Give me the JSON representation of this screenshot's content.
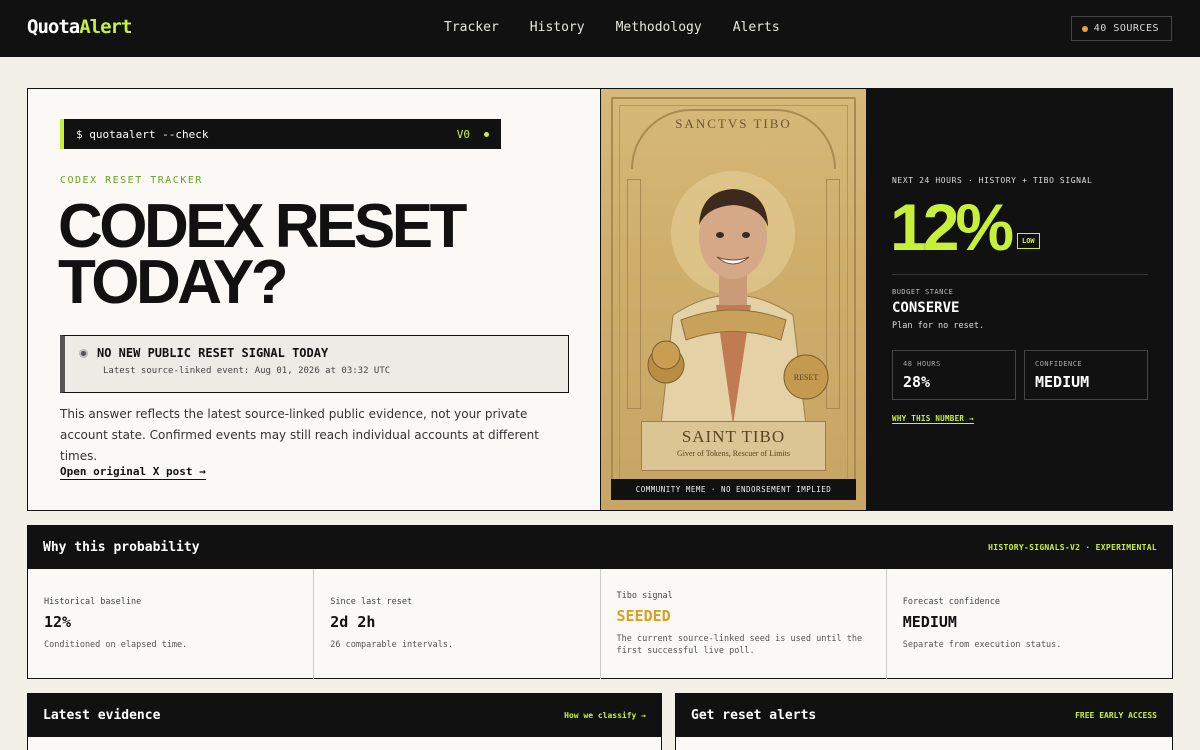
{
  "header": {
    "logo_main": "Quota",
    "logo_accent": "Alert",
    "nav": [
      "Tracker",
      "History",
      "Methodology",
      "Alerts"
    ],
    "sources_label": "40 SOURCES"
  },
  "hero": {
    "command": "$ quotaalert --check",
    "version": "V0",
    "eyebrow": "CODEX RESET TRACKER",
    "headline_line1": "CODEX RESET",
    "headline_line2": "TODAY?",
    "status_title": "NO NEW PUBLIC RESET SIGNAL TODAY",
    "status_sub": "Latest source-linked event: Aug 01, 2026 at 03:32 UTC",
    "explain": "This answer reflects the latest source-linked public evidence, not your private account state. Confirmed events may still reach individual accounts at different times.",
    "xlink": "Open original X post →"
  },
  "meme": {
    "top_text": "SANCTVS TIBO",
    "banner_name": "SAINT TIBO",
    "banner_sub": "Giver of Tokens, Rescuer of Limits",
    "coin_label": "RESET",
    "tag": "COMMUNITY MEME · NO ENDORSEMENT IMPLIED"
  },
  "forecast": {
    "eyebrow": "NEXT 24 HOURS · HISTORY + TIBO SIGNAL",
    "percent": "12%",
    "level": "LOW",
    "stance_label": "BUDGET STANCE",
    "stance_value": "CONSERVE",
    "stance_sub": "Plan for no reset.",
    "h48_label": "48 HOURS",
    "h48_value": "28%",
    "confidence_label": "CONFIDENCE",
    "confidence_value": "MEDIUM",
    "why_link": "WHY THIS NUMBER →"
  },
  "why": {
    "title": "Why this probability",
    "tag": "HISTORY-SIGNALS-V2 · EXPERIMENTAL",
    "cells": [
      {
        "label": "Historical baseline",
        "value": "12%",
        "desc": "Conditioned on elapsed time."
      },
      {
        "label": "Since last reset",
        "value": "2d 2h",
        "desc": "26 comparable intervals."
      },
      {
        "label": "Tibo signal",
        "value": "SEEDED",
        "desc": "The current source-linked seed is used until the first successful live poll."
      },
      {
        "label": "Forecast confidence",
        "value": "MEDIUM",
        "desc": "Separate from execution status."
      }
    ]
  },
  "evidence": {
    "title": "Latest evidence",
    "tag": "How we classify →"
  },
  "alerts": {
    "title": "Get reset alerts",
    "tag": "FREE EARLY ACCESS"
  },
  "colors": {
    "accent": "#c8f03a",
    "seed": "#d9a020",
    "dark": "#111111"
  }
}
